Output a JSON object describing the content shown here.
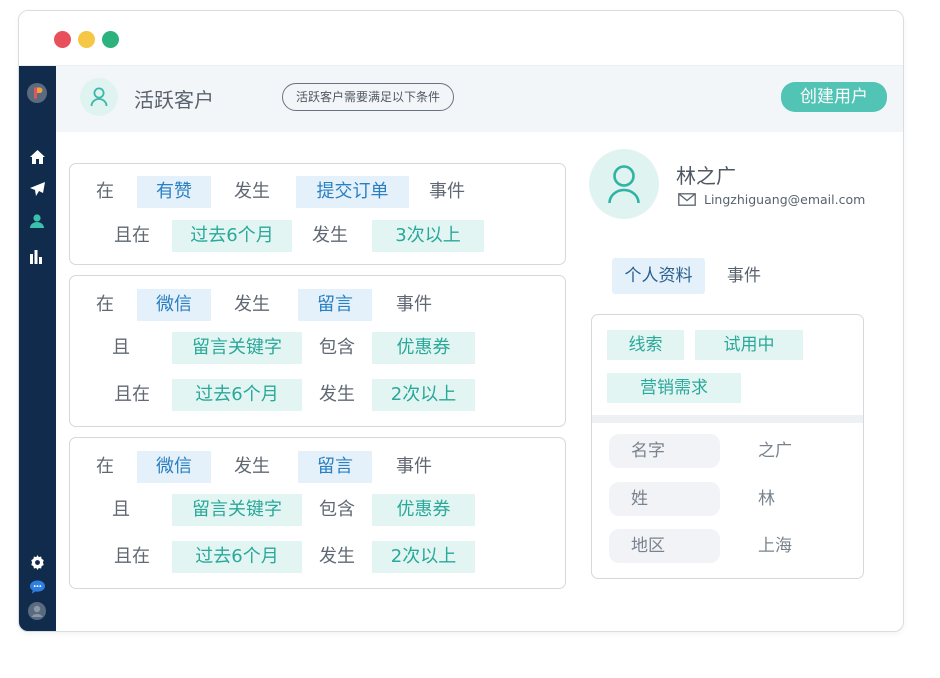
{
  "window": {
    "dots": [
      "#e8505b",
      "#f6c744",
      "#2bb27d"
    ]
  },
  "sidebar": {
    "icons": [
      "app-logo-icon",
      "home-icon",
      "send-icon",
      "user-icon",
      "bar-chart-icon",
      "gear-icon",
      "chat-icon",
      "avatar-icon"
    ],
    "colors": {
      "bg": "#112b4d",
      "active": "#3bc0ad"
    }
  },
  "header": {
    "title": "活跃客户",
    "condition_pill": "活跃客户需要满足以下条件",
    "create_button": "创建用户"
  },
  "rules": [
    {
      "rows": [
        [
          "在",
          "有赞",
          "发生",
          "提交订单",
          "事件"
        ],
        [
          "且在",
          "过去6个月",
          "发生",
          "3次以上"
        ]
      ]
    },
    {
      "rows": [
        [
          "在",
          "微信",
          "发生",
          "留言",
          "事件"
        ],
        [
          "且",
          "留言关键字",
          "包含",
          "优惠券"
        ],
        [
          "且在",
          "过去6个月",
          "发生",
          "2次以上"
        ]
      ]
    },
    {
      "rows": [
        [
          "在",
          "微信",
          "发生",
          "留言",
          "事件"
        ],
        [
          "且",
          "留言关键字",
          "包含",
          "优惠券"
        ],
        [
          "且在",
          "过去6个月",
          "发生",
          "2次以上"
        ]
      ]
    }
  ],
  "profile": {
    "name": "林之广",
    "email": "Lingzhiguang@email.com",
    "tabs": [
      "个人资料",
      "事件"
    ],
    "tags": [
      "线索",
      "试用中",
      "营销需求"
    ],
    "fields": [
      {
        "label": "名字",
        "value": "之广"
      },
      {
        "label": "姓",
        "value": "林"
      },
      {
        "label": "地区",
        "value": "上海"
      }
    ]
  }
}
